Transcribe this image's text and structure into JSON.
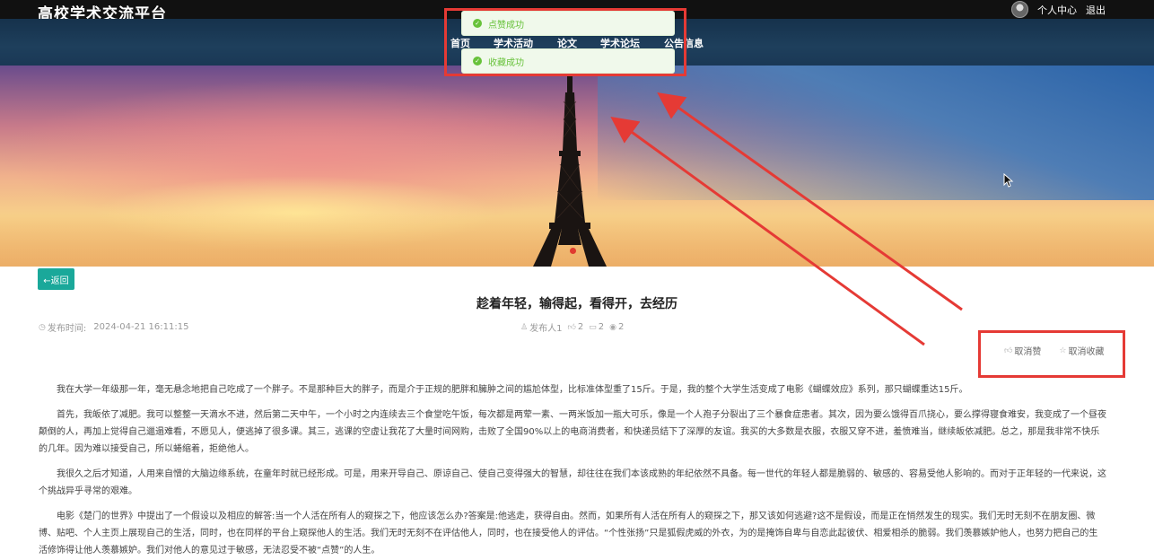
{
  "header": {
    "brand": "高校学术交流平台",
    "user_center": "个人中心",
    "logout": "退出"
  },
  "nav": {
    "items": [
      "首页",
      "学术活动",
      "论文",
      "学术论坛",
      "公告信息"
    ]
  },
  "toasts": {
    "like_success": "点赞成功",
    "favorite_success": "收藏成功"
  },
  "article": {
    "back_label": "←返回",
    "title": "趁着年轻，输得起，看得开，去经历",
    "publish_time_label": "发布时间:",
    "publish_time": "2024-04-21 16:11:15",
    "publisher": "发布人1",
    "likes": "2",
    "dislikes": "2",
    "views": "2",
    "cancel_like": "取消赞",
    "cancel_favorite": "取消收藏",
    "paragraphs": [
      "我在大学一年级那一年，毫无悬念地把自己吃成了一个胖子。不是那种巨大的胖子，而是介于正规的肥胖和臃肿之间的尴尬体型，比标准体型重了15斤。于是，我的整个大学生活变成了电影《蝴蝶效应》系列，那只蝴蝶重达15斤。",
      "首先，我皈依了减肥。我可以整整一天滴水不进，然后第二天中午，一个小时之内连续去三个食堂吃午饭，每次都是两荤一素、一两米饭加一瓶大可乐，像是一个人孢子分裂出了三个暴食症患者。其次，因为要么饿得百爪挠心，要么撑得寝食难安，我变成了一个昼夜颠倒的人，再加上觉得自己邋遢难看，不愿见人，便逃掉了很多课。其三，逃课的空虚让我花了大量时间网购，击败了全国90%以上的电商消费者，和快递员结下了深厚的友谊。我买的大多数是衣服，衣服又穿不进，羞愤难当，继续皈依减肥。总之，那是我非常不快乐的几年。因为难以接受自己，所以蜷缩着，拒绝他人。",
      "我很久之后才知道，人用来自憎的大脑边缘系统，在童年时就已经形成。可是，用来开导自己、原谅自己、使自己变得强大的智慧，却往往在我们本该成熟的年纪依然不具备。每一世代的年轻人都是脆弱的、敏感的、容易受他人影响的。而对于正年轻的一代来说，这个挑战异乎寻常的艰难。",
      "电影《楚门的世界》中提出了一个假设以及相应的解答:当一个人活在所有人的窥探之下，他应该怎么办?答案是:他逃走，获得自由。然而，如果所有人活在所有人的窥探之下，那又该如何逃避?这不是假设，而是正在悄然发生的现实。我们无时无刻不在朋友圈、微博、贴吧、个人主页上展现自己的生活，同时，也在同样的平台上窥探他人的生活。我们无时无刻不在评估他人，同时，也在接受他人的评估。“个性张扬”只是狐假虎威的外衣，为的是掩饰自卑与自恋此起彼伏、相爱相杀的脆弱。我们羡慕嫉妒他人，也努力把自己的生活修饰得让他人羡慕嫉妒。我们对他人的意见过于敏感，无法忍受不被“点赞”的人生。"
    ]
  },
  "colors": {
    "accent": "#1aa89a",
    "annotation": "#e53a35",
    "toast_green": "#67c23a"
  }
}
